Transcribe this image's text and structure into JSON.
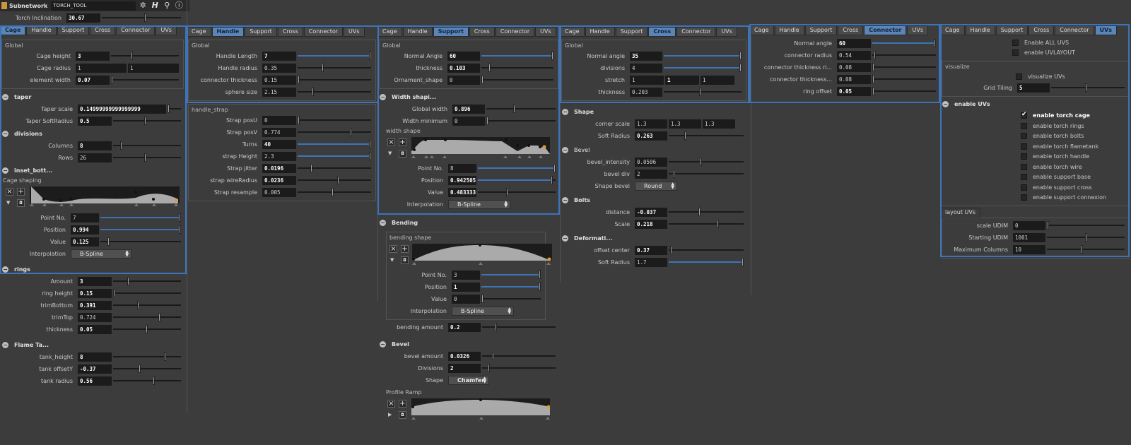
{
  "header": {
    "node_type": "Subnetwork",
    "node_name": "TORCH_TOOL",
    "torch_inclination_label": "Torch Inclination",
    "torch_inclination": "30.67"
  },
  "tabs": [
    "Cage",
    "Handle",
    "Support",
    "Cross",
    "Connector",
    "UVs"
  ],
  "cage": {
    "global_label": "Global",
    "cage_height_label": "Cage height",
    "cage_height": "3",
    "cage_radius_label": "Cage radius",
    "cage_radius_a": "1",
    "cage_radius_b": "1",
    "element_width_label": "element width",
    "element_width": "0.07",
    "taper": "taper",
    "taper_scale_label": "Taper scale",
    "taper_scale": "0.14999999999999999",
    "taper_soft_label": "Taper SoftRadius",
    "taper_soft": "0.5",
    "divisions": "divisions",
    "columns_label": "Columns",
    "columns": "8",
    "rows_label": "Rows",
    "rows": "26",
    "inset": "inset_bott...",
    "cage_shaping": "Cage shaping",
    "point_no_label": "Point No.",
    "point_no": "7",
    "position_label": "Position",
    "position": "0.994",
    "value_label": "Value",
    "value": "0.125",
    "interp_label": "Interpolation",
    "interp": "B-Spline",
    "rings": "rings",
    "amount_label": "Amount",
    "amount": "3",
    "ring_height_label": "ring height",
    "ring_height": "0.15",
    "trim_bottom_label": "trimBottom",
    "trim_bottom": "0.391",
    "trim_top_label": "trimTop",
    "trim_top": "0.724",
    "thickness_label": "thickness",
    "thickness": "0.05",
    "flame": "Flame Ta...",
    "tank_height_label": "tank_height",
    "tank_height": "8",
    "tank_offset_label": "tank offsetY",
    "tank_offset": "-0.37",
    "tank_radius_label": "tank radius",
    "tank_radius": "0.56"
  },
  "handle": {
    "global_label": "Global",
    "handle_length_label": "Handle Length",
    "handle_length": "7",
    "handle_radius_label": "Handle radius",
    "handle_radius": "0.35",
    "connector_thickness_label": "connector thickness",
    "connector_thickness": "0.15",
    "sphere_size_label": "sphere size",
    "sphere_size": "2.15",
    "strap_label": "handle_strap",
    "strap_posu_label": "Strap posU",
    "strap_posu": "0",
    "strap_posv_label": "Strap posV",
    "strap_posv": "0.774",
    "turns_label": "Turns",
    "turns": "40",
    "strap_height_label": "strap Height",
    "strap_height": "2.3",
    "strap_jitter_label": "Strap jitter",
    "strap_jitter": "0.0196",
    "strap_wire_label": "strap wireRadius",
    "strap_wire": "0.0236",
    "strap_resample_label": "Strap resample",
    "strap_resample": "0.005"
  },
  "support": {
    "global_label": "Global",
    "normal_angle_label": "Normal Angle",
    "normal_angle": "60",
    "thickness_label": "thickness",
    "thickness": "0.103",
    "ornament_label": "Ornament_shape",
    "ornament": "0",
    "width_sect": "Width shapi...",
    "global_width_label": "Global width",
    "global_width": "0.896",
    "width_min_label": "Width minimum",
    "width_min": "0",
    "width_shape_label": "width shape",
    "point_no_label": "Point No.",
    "point_no": "8",
    "position_label": "Position",
    "position": "0.942505",
    "value_label": "Value",
    "value": "0.483333",
    "interp_label": "Interpolation",
    "interp": "B-Spline",
    "bending_sect": "Bending",
    "bending_shape_label": "bending shape",
    "b_point_no": "3",
    "b_position": "1",
    "b_value": "0",
    "b_interp": "B-Spline",
    "bending_amount_label": "bending amount",
    "bending_amount": "0.2",
    "bevel_sect": "Bevel",
    "bevel_amount_label": "bevel amount",
    "bevel_amount": "0.0326",
    "divisions_label": "Divisions",
    "divisions": "2",
    "shape_label": "Shape",
    "shape": "Chamfer",
    "profile_ramp_label": "Profile Ramp"
  },
  "cross": {
    "global_label": "Global",
    "normal_angle_label": "Normal angle",
    "normal_angle": "35",
    "divisions_label": "divisions",
    "divisions": "4",
    "stretch_label": "stretch",
    "stretch_a": "1",
    "stretch_b": "1",
    "stretch_c": "1",
    "thickness_label": "thickness",
    "thickness": "0.203",
    "shape_sect": "Shape",
    "corner_scale_label": "corner scale",
    "corner_a": "1.3",
    "corner_b": "1.3",
    "corner_c": "1.3",
    "soft_radius_label": "Soft Radius",
    "soft_radius": "0.263",
    "bevel_sect": "Bevel",
    "bevel_intensity_label": "bevel_intensity",
    "bevel_intensity": "0.0506",
    "bevel_div_label": "bevel div",
    "bevel_div": "2",
    "shape_bevel_label": "Shape bevel",
    "shape_bevel": "Round",
    "bolts_sect": "Bolts",
    "distance_label": "distance",
    "distance": "-0.037",
    "scale_label": "Scale",
    "scale": "0.218",
    "deform_sect": "Deformati...",
    "offset_center_label": "offset center",
    "offset_center": "0.37",
    "d_soft_label": "Soft Radius",
    "d_soft": "1.7"
  },
  "connector": {
    "normal_angle_label": "Normal angle",
    "normal_angle": "60",
    "connector_radius_label": "connector radius",
    "connector_radius": "0.54",
    "ct_ri_label": "connector thickness ri...",
    "ct_ri": "0.08",
    "ct_label": "connector thickness...",
    "ct": "0.08",
    "ring_offset_label": "ring offset",
    "ring_offset": "0.05"
  },
  "uvs": {
    "enable_all": "Enable ALL UVS",
    "enable_uvlayout": "enable UVLAYOUT",
    "visualize_label": "visualize",
    "visualize_uvs": "visualize UVs",
    "grid_tiling_label": "Grid Tiling",
    "grid_tiling": "5",
    "enable_uvs_sect": "enable UVs",
    "items": [
      "enable torch cage",
      "enable torch rings",
      "enable torch bolts",
      "enable torch flametank",
      "enable torch handle",
      "enable torch wire",
      "enable support base",
      "enable support cross",
      "enable support connexion"
    ],
    "layout_tab": "layout UVs",
    "scale_udim_label": "scale UDIM",
    "scale_udim": "0",
    "starting_udim_label": "Starting UDIM",
    "starting_udim": "1001",
    "max_columns_label": "Maximum Columns",
    "max_columns": "10"
  }
}
